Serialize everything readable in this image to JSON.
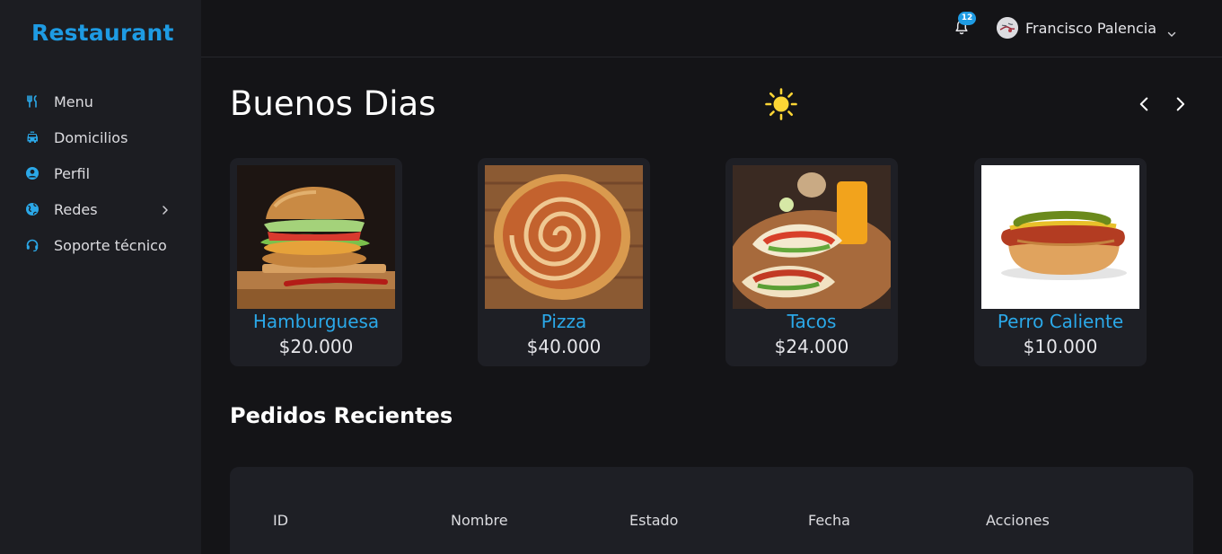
{
  "app": {
    "brand": "Restaurant"
  },
  "sidebar": {
    "items": [
      {
        "label": "Menu",
        "icon": "utensils-icon"
      },
      {
        "label": "Domicilios",
        "icon": "car-icon"
      },
      {
        "label": "Perfil",
        "icon": "user-circle-icon"
      },
      {
        "label": "Redes",
        "icon": "globe-icon",
        "has_submenu": true
      },
      {
        "label": "Soporte técnico",
        "icon": "headset-icon"
      }
    ]
  },
  "header": {
    "notifications_count": "12",
    "user_name": "Francisco Palencia"
  },
  "main": {
    "greeting": "Buenos Dias",
    "greeting_icon": "sun-icon",
    "products": [
      {
        "name": "Hamburguesa",
        "price": "$20.000",
        "image": "burger-image"
      },
      {
        "name": "Pizza",
        "price": "$40.000",
        "image": "pizza-image"
      },
      {
        "name": "Tacos",
        "price": "$24.000",
        "image": "tacos-image"
      },
      {
        "name": "Perro Caliente",
        "price": "$10.000",
        "image": "hotdog-image"
      }
    ],
    "orders": {
      "title": "Pedidos Recientes",
      "columns": [
        "ID",
        "Nombre",
        "Estado",
        "Fecha",
        "Acciones"
      ]
    }
  },
  "colors": {
    "accent": "#1e9be3",
    "background": "#141417",
    "sidebar": "#1c1d22",
    "card": "#1e1f25",
    "sun": "#fcd535"
  }
}
